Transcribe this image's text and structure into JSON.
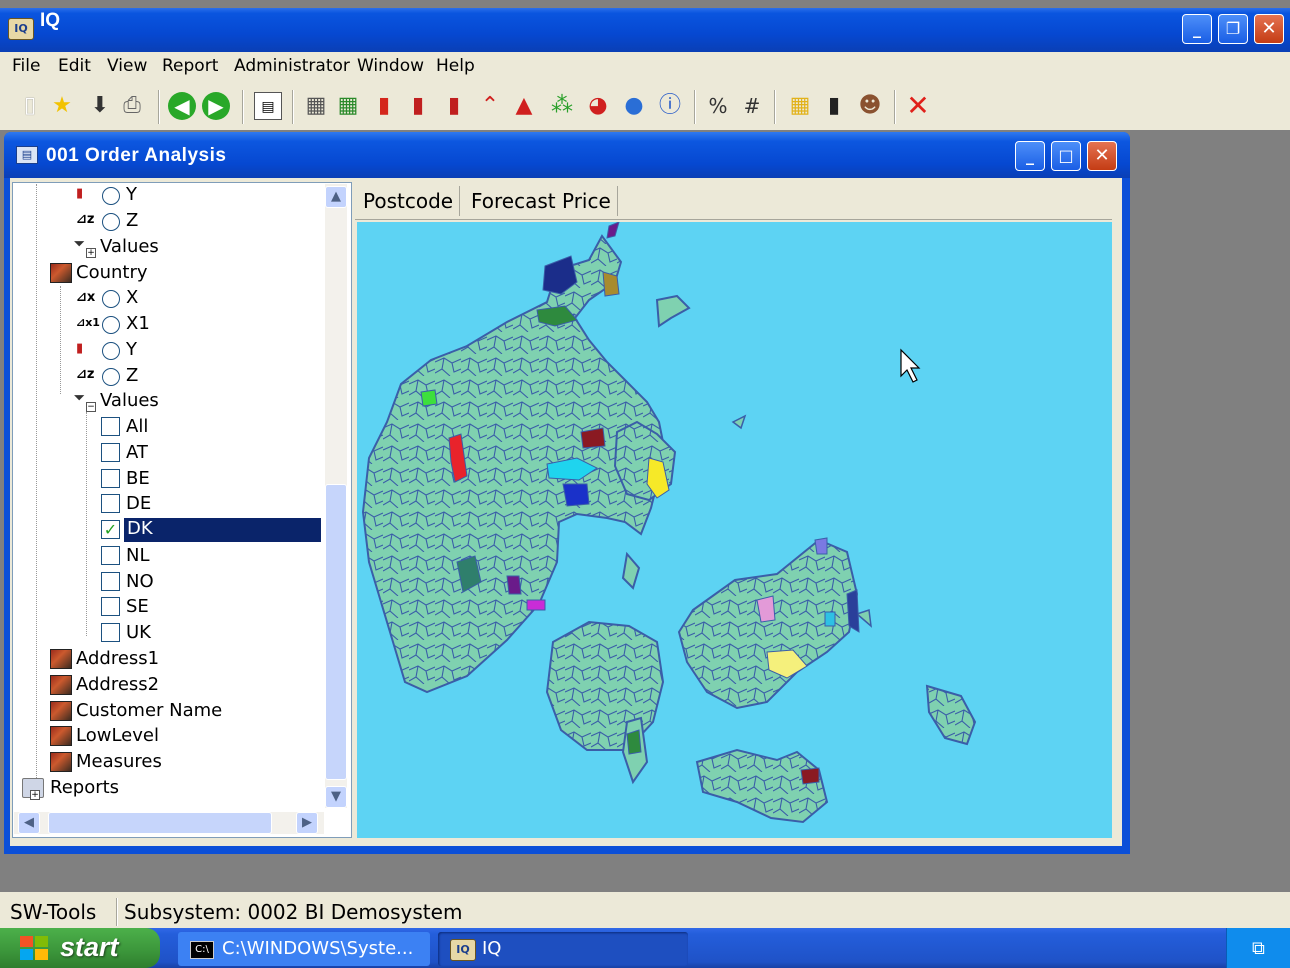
{
  "app": {
    "title": "IQ",
    "icon_text": "IQ"
  },
  "menu": [
    "File",
    "Edit",
    "View",
    "Report",
    "Administrator",
    "Window",
    "Help"
  ],
  "toolbar_icons": [
    "new-icon",
    "favorite-icon",
    "download-icon",
    "print-icon",
    "back-icon",
    "forward-icon",
    "layout-icon",
    "table-icon",
    "table-add-icon",
    "bar-chart-icon",
    "bar-chart2-icon",
    "bar-chart3-icon",
    "line-chart-icon",
    "area-chart-icon",
    "scatter-chart-icon",
    "pie-chart-icon",
    "globe-icon",
    "info-icon",
    "percent-icon",
    "number-icon",
    "grid-color-icon",
    "traffic-light-icon",
    "users-icon",
    "delete-icon"
  ],
  "child_window": {
    "title": "001  Order Analysis"
  },
  "tree": {
    "top_items": [
      {
        "label": "Y",
        "axis": "Y"
      },
      {
        "label": "Z",
        "axis": "Z"
      },
      {
        "label": "Values"
      }
    ],
    "country": {
      "label": "Country",
      "axes": [
        {
          "label": "X",
          "axis": "x"
        },
        {
          "label": "X1",
          "axis": "x1"
        },
        {
          "label": "Y",
          "axis": "Y"
        },
        {
          "label": "Z",
          "axis": "Z"
        }
      ],
      "values_label": "Values",
      "values": [
        {
          "label": "All",
          "checked": false
        },
        {
          "label": "AT",
          "checked": false
        },
        {
          "label": "BE",
          "checked": false
        },
        {
          "label": "DE",
          "checked": false
        },
        {
          "label": "DK",
          "checked": true
        },
        {
          "label": "NL",
          "checked": false
        },
        {
          "label": "NO",
          "checked": false
        },
        {
          "label": "SE",
          "checked": false
        },
        {
          "label": "UK",
          "checked": false
        }
      ]
    },
    "dimensions": [
      "Address1",
      "Address2",
      "Customer Name",
      "LowLevel",
      "Measures"
    ],
    "reports": "Reports"
  },
  "map": {
    "headers": [
      "Postcode",
      "Forecast Price"
    ],
    "sea_color": "#5dd3f3",
    "land_color": "#7fd1b0",
    "border_color": "#3a5ea8"
  },
  "status": {
    "left": "SW-Tools",
    "right": "Subsystem: 0002 BI Demosystem"
  },
  "taskbar": {
    "start": "start",
    "tasks": [
      "C:\\WINDOWS\\Syste...",
      "IQ"
    ]
  }
}
